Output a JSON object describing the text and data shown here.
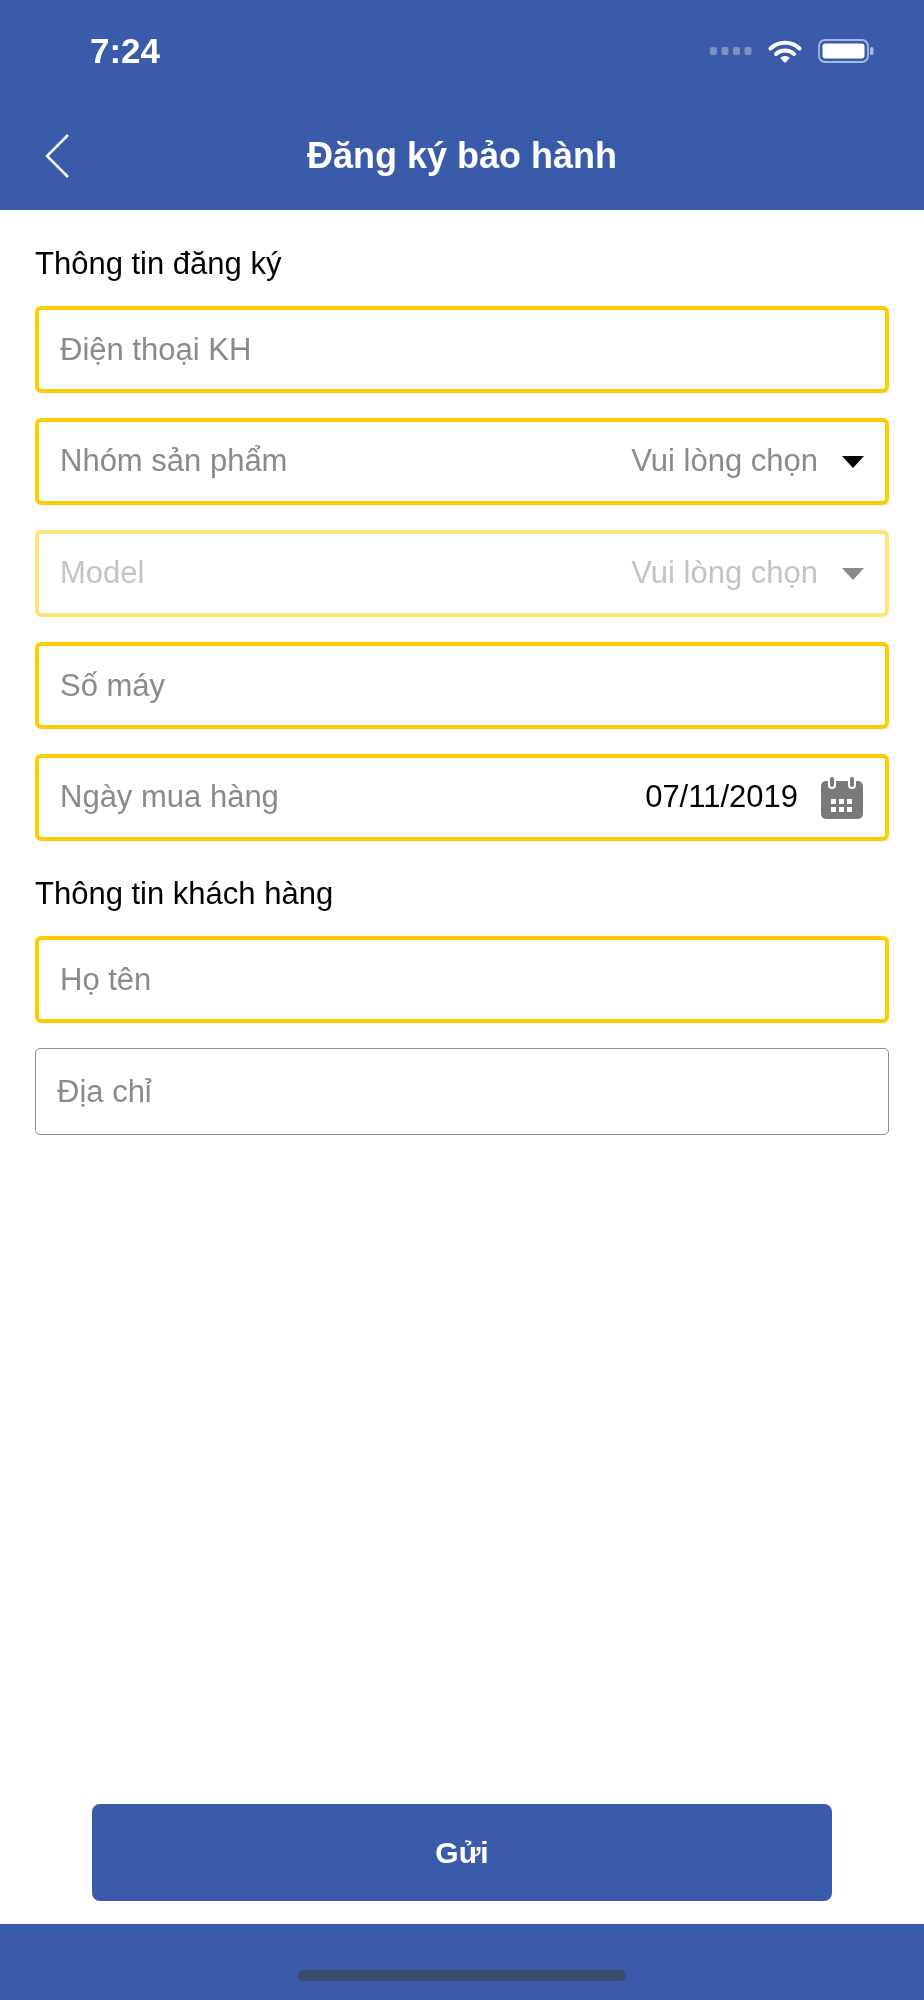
{
  "status_bar": {
    "time": "7:24"
  },
  "nav_bar": {
    "title": "Đăng ký bảo hành"
  },
  "sections": [
    {
      "heading": "Thông tin đăng ký",
      "fields": [
        {
          "kind": "text",
          "placeholder": "Điện thoại KH",
          "required": true,
          "disabled": false
        },
        {
          "kind": "dropdown",
          "label": "Nhóm sản phẩm",
          "placeholder": "Vui lòng chọn",
          "required": true,
          "disabled": false
        },
        {
          "kind": "dropdown",
          "label": "Model",
          "placeholder": "Vui lòng chọn",
          "required": true,
          "disabled": true
        },
        {
          "kind": "text",
          "placeholder": "Số máy",
          "required": true,
          "disabled": false
        },
        {
          "kind": "date",
          "label": "Ngày mua hàng",
          "value": "07/11/2019",
          "required": true,
          "disabled": false
        }
      ]
    },
    {
      "heading": "Thông tin khách hàng",
      "fields": [
        {
          "kind": "text",
          "placeholder": "Họ tên",
          "required": true,
          "disabled": false
        },
        {
          "kind": "text",
          "placeholder": "Địa chỉ",
          "required": false,
          "disabled": false
        }
      ]
    }
  ],
  "submit_button": {
    "label": "Gửi"
  }
}
